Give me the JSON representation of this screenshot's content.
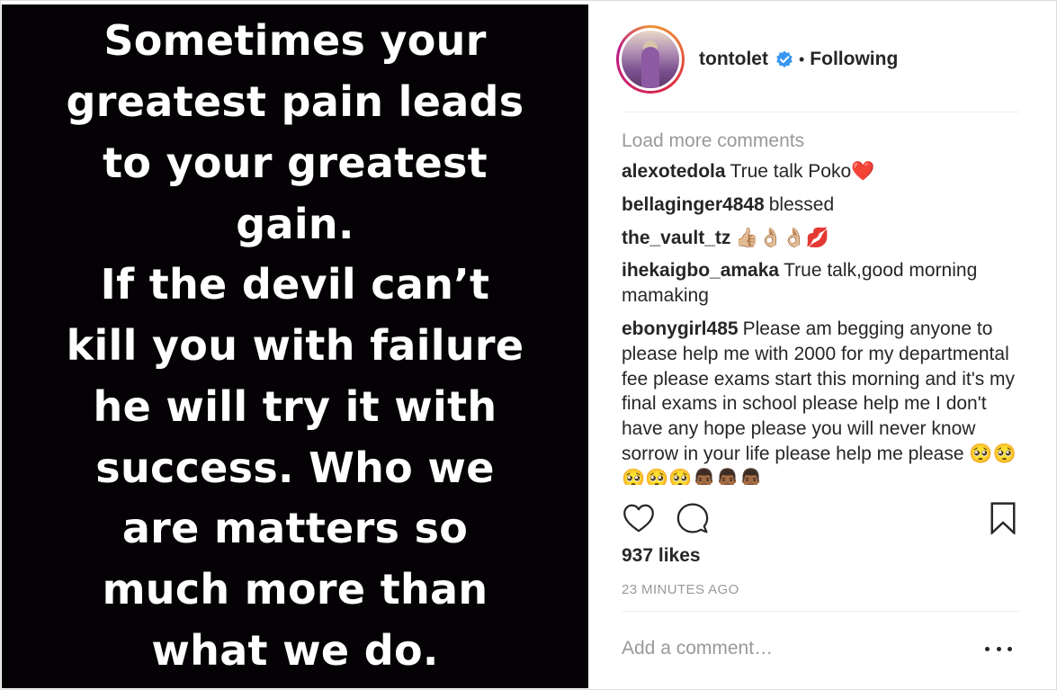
{
  "post": {
    "quote_lines": [
      "Sometimes your",
      "greatest pain leads",
      "to your greatest",
      "gain.",
      "If the devil can’t",
      "kill you with failure",
      "he will try it with",
      "success. Who we",
      "are matters so",
      "much more than",
      "what we do."
    ]
  },
  "header": {
    "username": "tontolet",
    "separator": "•",
    "follow_state": "Following",
    "verified_icon": "verified-badge-icon",
    "colors": {
      "verified": "#3897f0"
    }
  },
  "comments": {
    "load_more": "Load more comments",
    "items": [
      {
        "user": "alexotedola",
        "text": "True talk Poko",
        "emoji": "❤️"
      },
      {
        "user": "bellaginger4848",
        "text": "blessed",
        "emoji": ""
      },
      {
        "user": "the_vault_tz",
        "text": "",
        "emoji": "👍🏼👌🏼👌🏼💋"
      },
      {
        "user": "ihekaigbo_amaka",
        "text": "True talk,good morning mamaking",
        "emoji": ""
      },
      {
        "user": "ebonygirl485",
        "text": "Please am begging anyone to please help me with 2000 for my departmental fee please exams start this morning and it's my final exams in school please help me I don't have any hope please you will never know sorrow in your life please help me please",
        "emoji": "🥺🥺🥺🥺🥺👨🏾👨🏾👨🏾"
      }
    ]
  },
  "actions": {
    "like_icon": "heart-outline-icon",
    "comment_icon": "speech-bubble-icon",
    "save_icon": "bookmark-icon"
  },
  "likes": "937 likes",
  "time_ago": "23 MINUTES AGO",
  "add_comment": {
    "placeholder": "Add a comment…"
  },
  "more_icon": "more-options-icon"
}
